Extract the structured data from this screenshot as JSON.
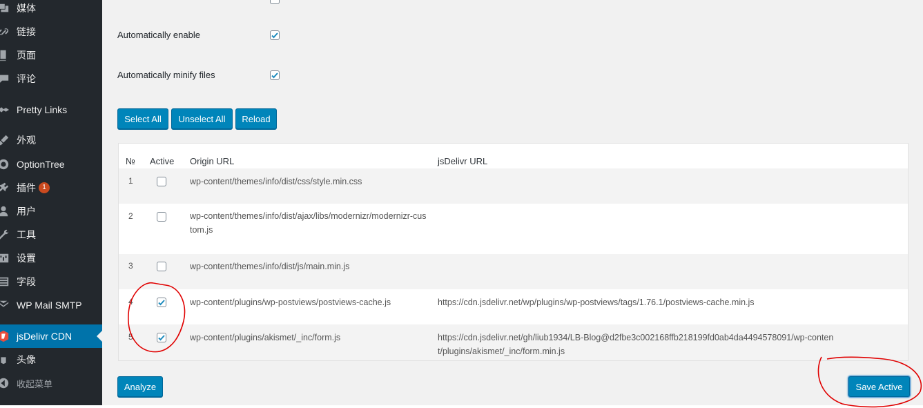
{
  "sidebar": {
    "items": [
      {
        "label": "媒体",
        "icon": "media-icon"
      },
      {
        "label": "链接",
        "icon": "link-icon"
      },
      {
        "label": "页面",
        "icon": "page-icon"
      },
      {
        "label": "评论",
        "icon": "comment-icon"
      },
      {
        "label": "Pretty Links",
        "icon": "pretty-links-icon"
      },
      {
        "label": "外观",
        "icon": "appearance-icon"
      },
      {
        "label": "OptionTree",
        "icon": "optiontree-icon"
      },
      {
        "label": "插件",
        "icon": "plugins-icon",
        "badge": "1"
      },
      {
        "label": "用户",
        "icon": "users-icon"
      },
      {
        "label": "工具",
        "icon": "tools-icon"
      },
      {
        "label": "设置",
        "icon": "settings-icon"
      },
      {
        "label": "字段",
        "icon": "fields-icon"
      },
      {
        "label": "WP Mail SMTP",
        "icon": "mail-icon"
      },
      {
        "label": "jsDelivr CDN",
        "icon": "jsdelivr-icon",
        "active": true
      },
      {
        "label": "头像",
        "icon": "avatar-icon"
      },
      {
        "label": "收起菜单",
        "icon": "collapse-icon"
      }
    ]
  },
  "options": {
    "auto_enable": {
      "label": "Automatically enable",
      "checked": true
    },
    "auto_minify": {
      "label": "Automatically minify files",
      "checked": true
    }
  },
  "buttons": {
    "select_all": "Select All",
    "unselect_all": "Unselect All",
    "reload": "Reload",
    "analyze": "Analyze",
    "save_active": "Save Active"
  },
  "table": {
    "headers": {
      "num": "№",
      "active": "Active",
      "origin": "Origin URL",
      "jsdelivr": "jsDelivr URL"
    },
    "rows": [
      {
        "num": "1",
        "active": false,
        "origin": "wp-content/themes/info/dist/css/style.min.css",
        "jsdelivr": ""
      },
      {
        "num": "2",
        "active": false,
        "origin": "wp-content/themes/info/dist/ajax/libs/modernizr/modernizr-custom.js",
        "jsdelivr": ""
      },
      {
        "num": "3",
        "active": false,
        "origin": "wp-content/themes/info/dist/js/main.min.js",
        "jsdelivr": ""
      },
      {
        "num": "4",
        "active": true,
        "origin": "wp-content/plugins/wp-postviews/postviews-cache.js",
        "jsdelivr": "https://cdn.jsdelivr.net/wp/plugins/wp-postviews/tags/1.76.1/postviews-cache.min.js"
      },
      {
        "num": "5",
        "active": true,
        "origin": "wp-content/plugins/akismet/_inc/form.js",
        "jsdelivr": "https://cdn.jsdelivr.net/gh/liub1934/LB-Blog@d2fbe3c002168ffb218199fd0ab4da4494578091/wp-content/plugins/akismet/_inc/form.min.js"
      }
    ]
  },
  "colors": {
    "sidebar_bg": "#23282d",
    "active_bg": "#0073aa",
    "button_bg": "#0085ba",
    "badge": "#ca4a1f",
    "annotation": "#e00000"
  }
}
